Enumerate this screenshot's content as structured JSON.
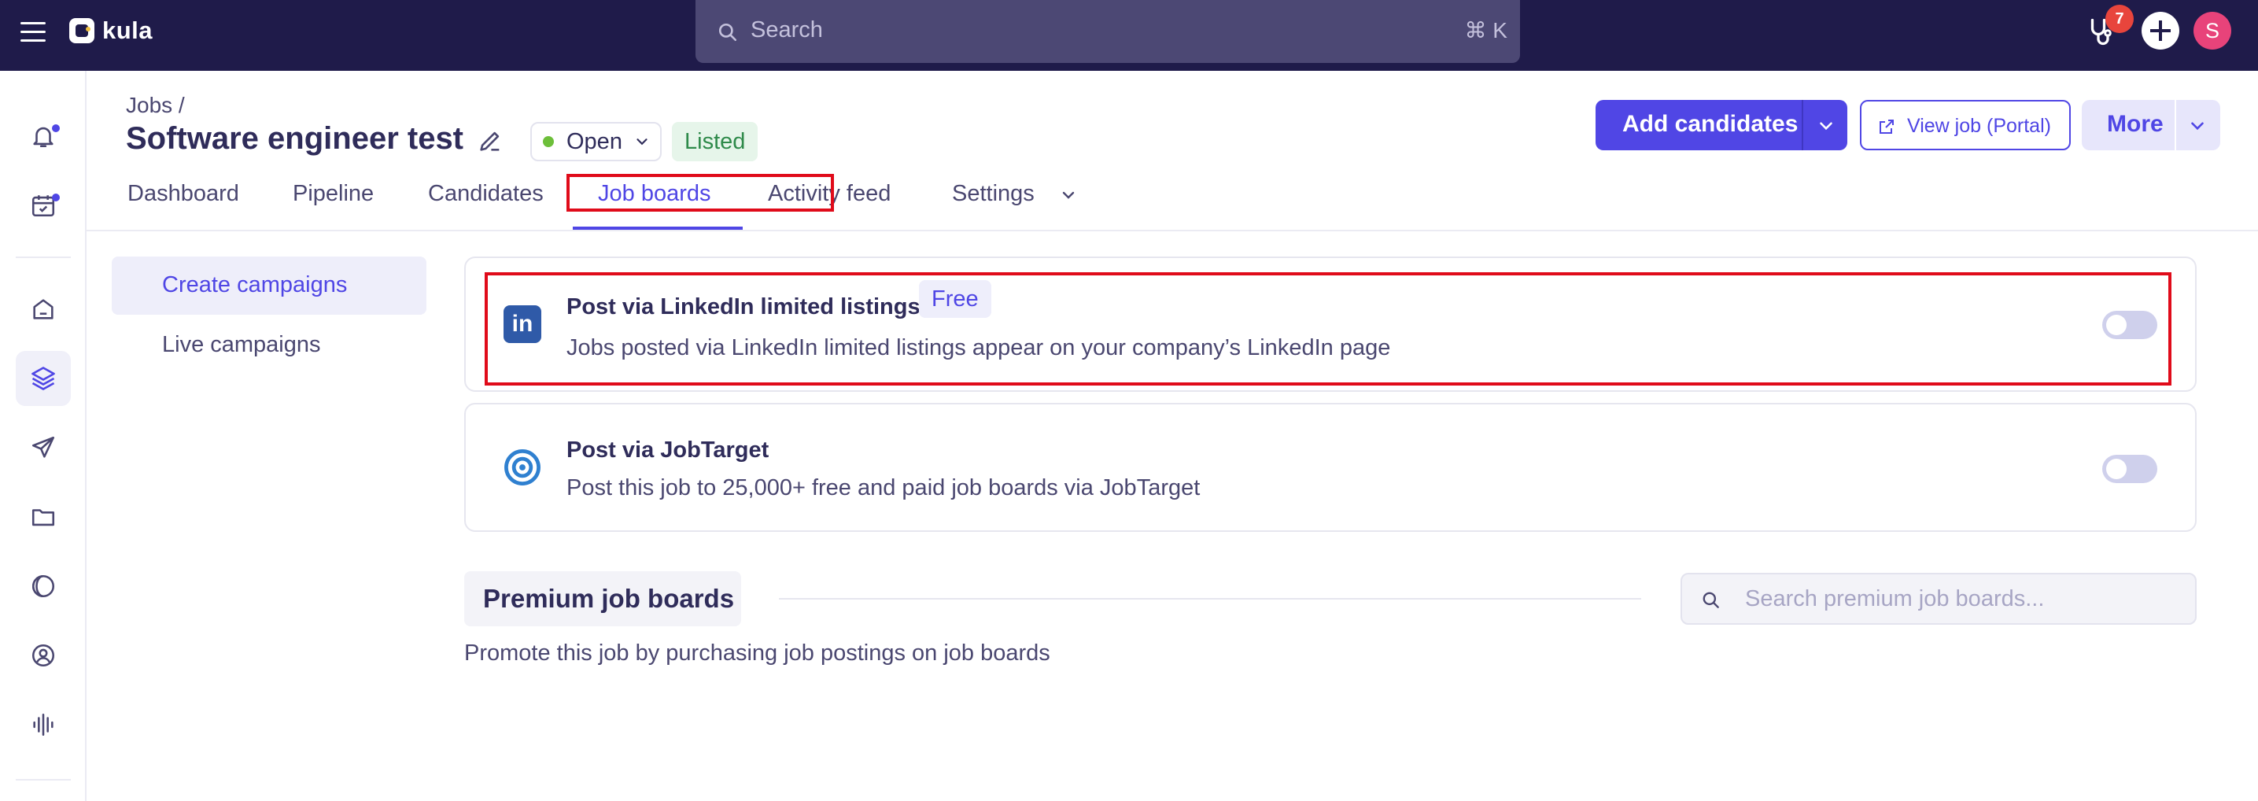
{
  "topbar": {
    "app_name": "kula",
    "search_label": "Search",
    "search_shortcut": "⌘ K",
    "notification_count": "7",
    "avatar_initial": "S"
  },
  "header": {
    "breadcrumb": "Jobs /",
    "title": "Software engineer test",
    "status": "Open",
    "listed_badge": "Listed",
    "add_candidates_label": "Add candidates",
    "view_job_label": "View job (Portal)",
    "more_label": "More"
  },
  "tabs": [
    {
      "label": "Dashboard"
    },
    {
      "label": "Pipeline"
    },
    {
      "label": "Candidates"
    },
    {
      "label": "Job boards"
    },
    {
      "label": "Activity feed"
    },
    {
      "label": "Settings"
    }
  ],
  "subnav": [
    {
      "label": "Create campaigns"
    },
    {
      "label": "Live campaigns"
    }
  ],
  "boards": [
    {
      "title": "Post via LinkedIn limited listings",
      "badge": "Free",
      "description": "Jobs posted via LinkedIn limited listings appear on your company’s LinkedIn page",
      "enabled": false
    },
    {
      "title": "Post via JobTarget",
      "description": "Post this job to 25,000+ free and paid job boards via JobTarget",
      "enabled": false
    }
  ],
  "premium": {
    "heading": "Premium job boards",
    "search_placeholder": "Search premium job boards...",
    "description": "Promote this job by purchasing job postings on job boards"
  },
  "colors": {
    "topbar": "#1f1b4a",
    "accent": "#5046e5",
    "highlight": "#e00b1a",
    "status_open": "#6dbf3a"
  }
}
